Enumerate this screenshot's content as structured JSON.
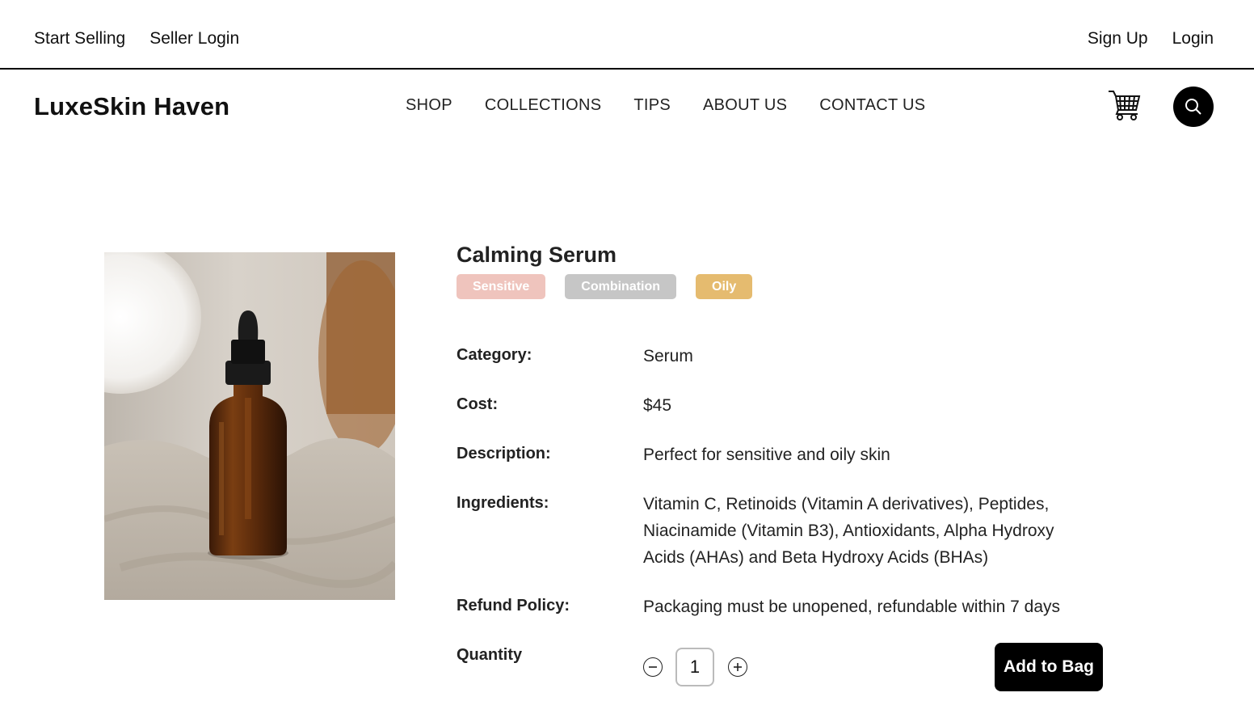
{
  "topbar": {
    "start_selling": "Start Selling",
    "seller_login": "Seller Login",
    "sign_up": "Sign Up",
    "login": "Login"
  },
  "header": {
    "brand": "LuxeSkin Haven",
    "nav": [
      "SHOP",
      "COLLECTIONS",
      "TIPS",
      "ABOUT US",
      "CONTACT US"
    ],
    "icons": {
      "cart": "cart-icon",
      "search": "search-icon"
    }
  },
  "product": {
    "name": "Calming Serum",
    "tags": [
      {
        "label": "Sensitive",
        "color": "#efc4bd"
      },
      {
        "label": "Combination",
        "color": "#c6c6c6"
      },
      {
        "label": "Oily",
        "color": "#e5bb6f"
      }
    ],
    "category_label": "Category:",
    "category": "Serum",
    "cost_label": "Cost:",
    "cost": "$45",
    "description_label": "Description:",
    "description": "Perfect for sensitive and oily skin",
    "ingredients_label": "Ingredients:",
    "ingredients": "Vitamin C, Retinoids (Vitamin A derivatives), Peptides, Niacinamide (Vitamin B3), Antioxidants, Alpha Hydroxy Acids (AHAs) and Beta Hydroxy Acids (BHAs)",
    "refund_label": "Refund Policy:",
    "refund": "Packaging must be unopened, refundable within 7 days",
    "quantity_label": "Quantity",
    "quantity": "1",
    "add_to_bag": "Add to Bag"
  }
}
